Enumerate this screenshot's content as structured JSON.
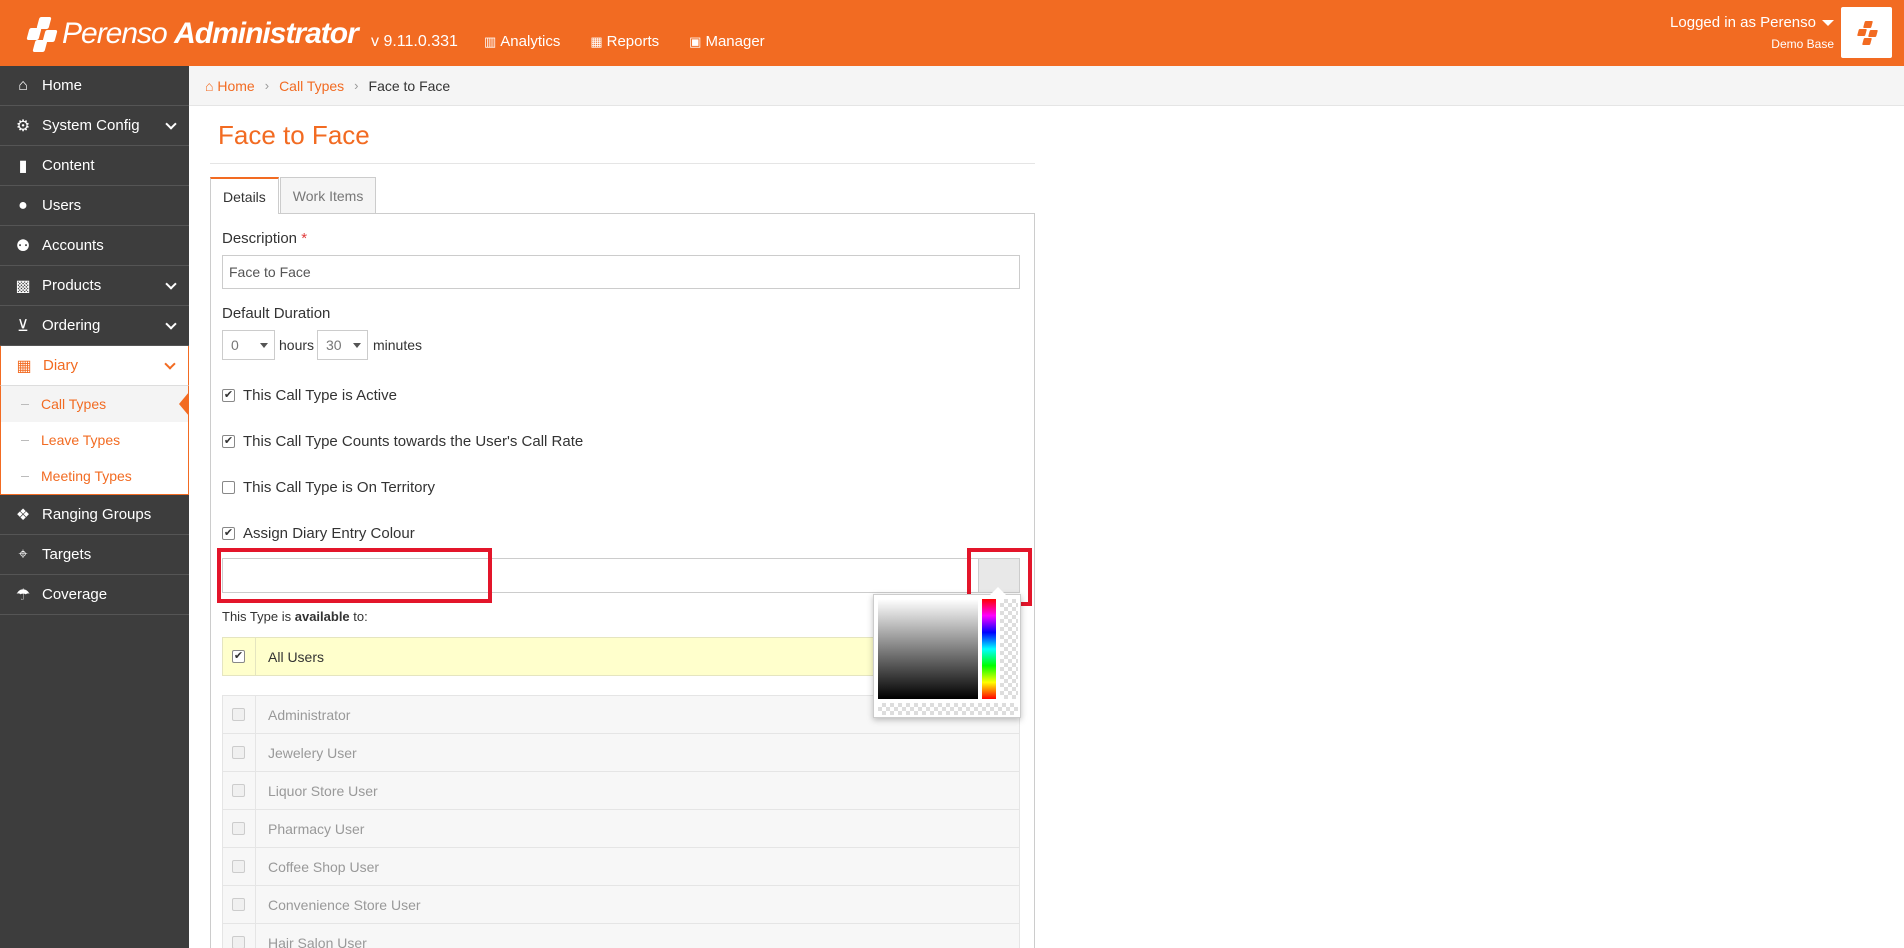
{
  "header": {
    "brand_light": "Perenso",
    "brand_bold": "Administrator",
    "version": "v 9.11.0.331",
    "nav": [
      {
        "label": "Analytics",
        "icon": "chart-icon"
      },
      {
        "label": "Reports",
        "icon": "table-icon"
      },
      {
        "label": "Manager",
        "icon": "briefcase-icon"
      }
    ],
    "user_line": "Logged in as Perenso",
    "base_line": "Demo Base",
    "accent": "#f26b22"
  },
  "sidebar": {
    "items": [
      {
        "label": "Home",
        "icon": "home-icon"
      },
      {
        "label": "System Config",
        "icon": "gear-icon"
      },
      {
        "label": "Content",
        "icon": "file-icon"
      },
      {
        "label": "Users",
        "icon": "user-icon"
      },
      {
        "label": "Accounts",
        "icon": "users-icon"
      },
      {
        "label": "Products",
        "icon": "gift-icon"
      },
      {
        "label": "Ordering",
        "icon": "cart-icon"
      },
      {
        "label": "Diary",
        "icon": "calendar-icon"
      },
      {
        "label": "Ranging Groups",
        "icon": "cubes-icon"
      },
      {
        "label": "Targets",
        "icon": "crosshair-icon"
      },
      {
        "label": "Coverage",
        "icon": "umbrella-icon"
      }
    ],
    "diary_sub": [
      "Call Types",
      "Leave Types",
      "Meeting Types"
    ]
  },
  "breadcrumb": {
    "home": "Home",
    "parent": "Call Types",
    "current": "Face to Face"
  },
  "page": {
    "title": "Face to Face",
    "tabs": [
      "Details",
      "Work Items"
    ]
  },
  "form": {
    "description_label": "Description",
    "required_mark": "*",
    "description_value": "Face to Face",
    "duration_label": "Default Duration",
    "hours_value": "0",
    "hours_label": "hours",
    "minutes_value": "30",
    "minutes_label": "minutes",
    "checks": [
      {
        "label": "This Call Type is Active",
        "checked": true
      },
      {
        "label": "This Call Type Counts towards the User's Call Rate",
        "checked": true
      },
      {
        "label": "This Call Type is On Territory",
        "checked": false
      },
      {
        "label": "Assign Diary Entry Colour",
        "checked": true
      }
    ],
    "colour_value": "",
    "available_prefix": "This Type is ",
    "available_bold": "available",
    "available_suffix": " to:",
    "all_users": "All Users",
    "users": [
      "Administrator",
      "Jewelery User",
      "Liquor Store User",
      "Pharmacy User",
      "Coffee Shop User",
      "Convenience Store User",
      "Hair Salon User"
    ]
  }
}
